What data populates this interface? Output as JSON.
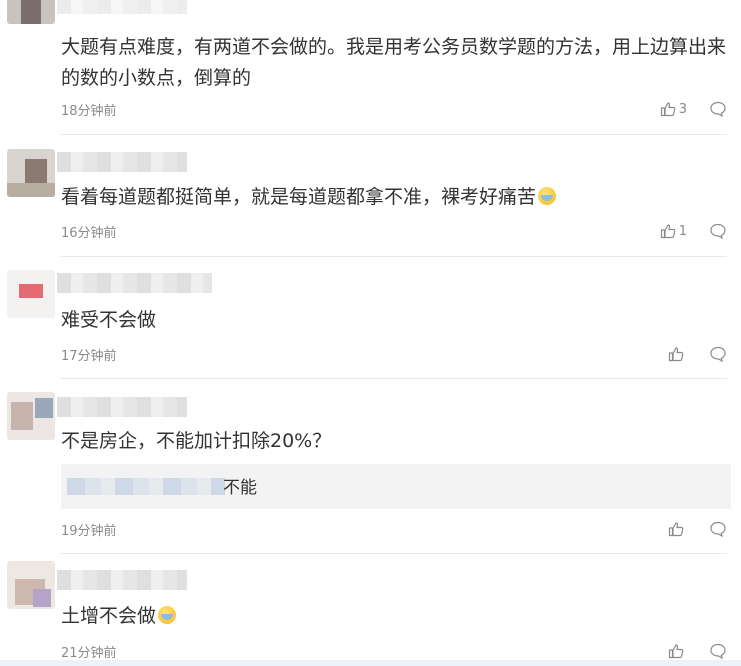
{
  "comments": [
    {
      "text": "大题有点难度，有两道不会做的。我是用考公务员数学题的方法，用上边算出来的数的小数点，倒算的",
      "time": "18分钟前",
      "likes": "3"
    },
    {
      "text": "看着每道题都挺简单，就是每道题都拿不准，裸考好痛苦",
      "time": "16分钟前",
      "likes": "1",
      "emoji": "crying-face-emoji"
    },
    {
      "text": "难受不会做",
      "time": "17分钟前",
      "likes": ""
    },
    {
      "text": "不是房企，不能加计扣除20%？",
      "time": "19分钟前",
      "likes": "",
      "reply": {
        "text": "不能"
      }
    },
    {
      "text": "土增不会做",
      "time": "21分钟前",
      "likes": "",
      "emoji": "crying-face-emoji"
    }
  ],
  "icons": {
    "like": "thumbs-up-icon",
    "reply": "speech-bubble-icon"
  },
  "colors": {
    "text": "#333333",
    "meta": "#8a8a8a",
    "divider": "#e8e8e8",
    "reply_bg": "#f3f3f3"
  }
}
